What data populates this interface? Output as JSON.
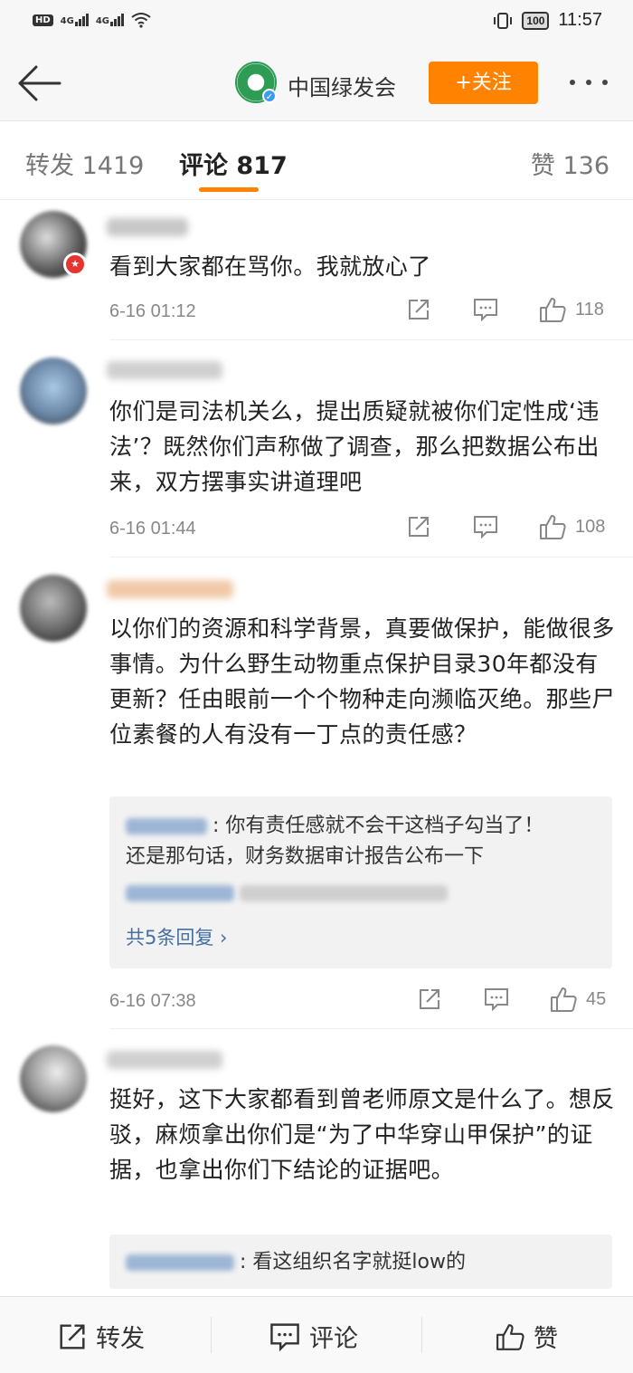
{
  "status_bar": {
    "hd": "HD",
    "net1": "4G",
    "net2": "4G",
    "battery": "100",
    "time": "11:57"
  },
  "header": {
    "org_name": "中国绿发会",
    "follow_label": "+关注",
    "accent_color": "#ff8200"
  },
  "tabs": {
    "repost": "转发 1419",
    "comment": "评论 817",
    "like": "赞 136"
  },
  "comments": [
    {
      "text": "看到大家都在骂你。我就放心了",
      "time": "6-16 01:12",
      "likes": "118"
    },
    {
      "text": "你们是司法机关么，提出质疑就被你们定性成‘违法’？既然你们声称做了调查，那么把数据公布出来，双方摆事实讲道理吧",
      "time": "6-16 01:44",
      "likes": "108"
    },
    {
      "text": "以你们的资源和科学背景，真要做保护，能做很多事情。为什么野生动物重点保护目录30年都没有更新？任由眼前一个个物种走向濒临灭绝。那些尸位素餐的人有没有一丁点的责任感？",
      "time": "6-16 07:38",
      "likes": "45",
      "replies": [
        ": 你有责任感就不会干这档子勾当了！",
        "还是那句话，财务数据审计报告公布一下"
      ],
      "more_replies": "共5条回复 ›"
    },
    {
      "text": "挺好，这下大家都看到曾老师原文是什么了。想反驳，麻烦拿出你们是“为了中华穿山甲保护”的证据，也拿出你们下结论的证据吧。",
      "reply": ": 看这组织名字就挺low的"
    }
  ],
  "bottom_bar": {
    "repost": "转发",
    "comment": "评论",
    "like": "赞"
  }
}
